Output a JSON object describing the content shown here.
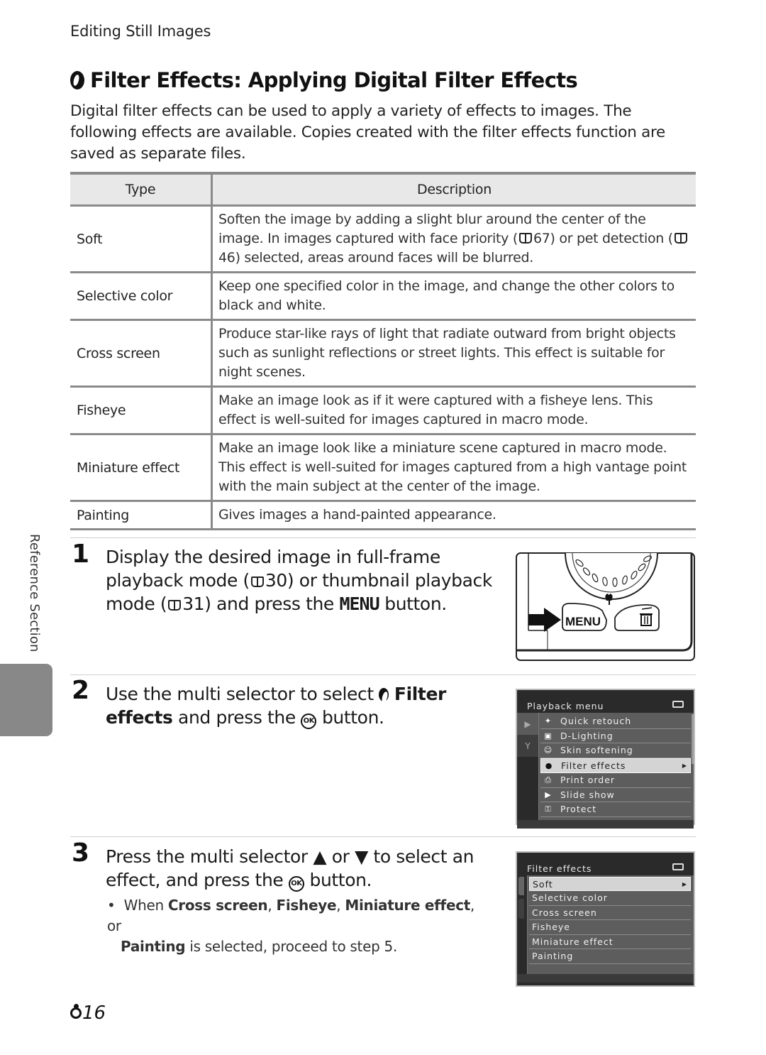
{
  "header": {
    "section_label": "Editing Still Images"
  },
  "title": {
    "icon": "filter-effects-icon",
    "text": "Filter Effects: Applying Digital Filter Effects"
  },
  "intro": "Digital filter effects can be used to apply a variety of effects to images. The following effects are available. Copies created with the filter effects function are saved as separate files.",
  "table": {
    "headers": [
      "Type",
      "Description"
    ],
    "rows": [
      {
        "type": "Soft",
        "desc_parts": [
          "Soften the image by adding a slight blur around the center of the image. In images captured with face priority (",
          "67) or pet detection (",
          "46) selected, areas around faces will be blurred."
        ]
      },
      {
        "type": "Selective color",
        "desc": "Keep one specified color in the image, and change the other colors to black and white."
      },
      {
        "type": "Cross screen",
        "desc": "Produce star-like rays of light that radiate outward from bright objects such as sunlight reflections or street lights. This effect is suitable for night scenes."
      },
      {
        "type": "Fisheye",
        "desc": "Make an image look as if it were captured with a fisheye lens. This effect is well-suited for images captured in macro mode."
      },
      {
        "type": "Miniature effect",
        "desc": "Make an image look like a miniature scene captured in macro mode. This effect is well-suited for images captured from a high vantage point with the main subject at the center of the image."
      },
      {
        "type": "Painting",
        "desc": "Gives images a hand-painted appearance."
      }
    ]
  },
  "steps": [
    {
      "number": "1",
      "parts": [
        "Display the desired image in full-frame playback mode (",
        "30) or thumbnail playback mode (",
        "31) and press the ",
        "MENU",
        " button."
      ]
    },
    {
      "number": "2",
      "parts": [
        "Use the multi selector to select ",
        "Filter effects",
        " and press the ",
        "OK",
        " button."
      ]
    },
    {
      "number": "3",
      "parts": [
        "Press the multi selector ",
        "▲",
        " or ",
        "▼",
        " to select an effect, and press the ",
        "OK",
        " button."
      ],
      "bullet_parts": [
        "When ",
        "Cross screen",
        ", ",
        "Fisheye",
        ", ",
        "Miniature effect",
        ", or ",
        "Painting",
        " is selected, proceed to step 5."
      ]
    }
  ],
  "camera_illustration": {
    "menu_label": "MENU",
    "delete_icon": "trash-icon",
    "macro_icon": "tulip-icon"
  },
  "playback_menu": {
    "title": "Playback menu",
    "items": [
      {
        "icon": "quick-retouch-icon",
        "glyph": "✦",
        "label": "Quick retouch"
      },
      {
        "icon": "d-lighting-icon",
        "glyph": "▣",
        "label": "D-Lighting"
      },
      {
        "icon": "skin-softening-icon",
        "glyph": "☺",
        "label": "Skin softening"
      },
      {
        "icon": "filter-effects-icon",
        "glyph": "●",
        "label": "Filter effects",
        "selected": true
      },
      {
        "icon": "print-order-icon",
        "glyph": "⎙",
        "label": "Print order"
      },
      {
        "icon": "slide-show-icon",
        "glyph": "▶",
        "label": "Slide show"
      },
      {
        "icon": "protect-icon",
        "glyph": "⚿",
        "label": "Protect"
      }
    ],
    "tabs": [
      {
        "icon": "playback-tab-icon",
        "glyph": "▶"
      },
      {
        "icon": "setup-tab-icon",
        "glyph": "Y"
      }
    ]
  },
  "filter_menu": {
    "title": "Filter effects",
    "items": [
      {
        "label": "Soft",
        "selected": true
      },
      {
        "label": "Selective color"
      },
      {
        "label": "Cross screen"
      },
      {
        "label": "Fisheye"
      },
      {
        "label": "Miniature effect"
      },
      {
        "label": "Painting"
      }
    ]
  },
  "side_tab": {
    "label": "Reference Section"
  },
  "footer": {
    "page_prefix": "E",
    "page_number": "16"
  }
}
